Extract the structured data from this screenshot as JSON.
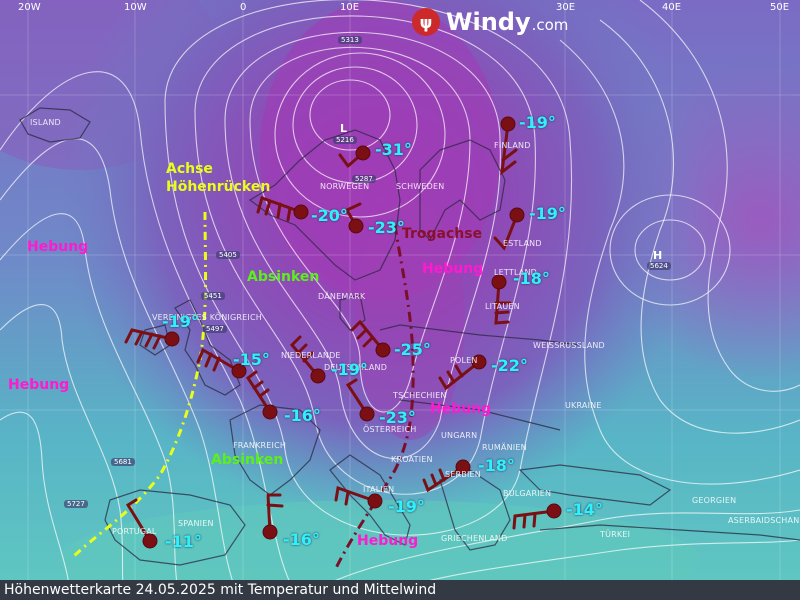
{
  "brand": {
    "name": "Windy",
    "suffix": ".com",
    "icon": "windy-logo-icon"
  },
  "caption": "Höhenwetterkarte 24.05.2025 mit Temperatur und Mittelwind",
  "longitudes": [
    "20W",
    "10W",
    "0",
    "10E",
    "30E",
    "40E",
    "50E"
  ],
  "pressure_labels": [
    "5313",
    "5216",
    "5287",
    "5405",
    "5451",
    "5497",
    "5681",
    "5727",
    "5624"
  ],
  "systems": {
    "low": "L",
    "high": "H"
  },
  "annotations": {
    "achse": [
      "Achse",
      "Höhenrücken"
    ],
    "trogachse": "Trogachse",
    "hebung": "Hebung",
    "absinken": "Absinken"
  },
  "countries": [
    "ISLAND",
    "FINLAND",
    "NORWEGEN",
    "SCHWEDEN",
    "ESTLAND",
    "LETTLAND",
    "LITAUEN",
    "DÄNEMARK",
    "VEREINIGTES KÖNIGREICH",
    "NIEDERLANDE",
    "DEUTSCHLAND",
    "POLEN",
    "WEISSRUSSLAND",
    "TSCHECHIEN",
    "ÖSTERREICH",
    "UKRAINE",
    "UNGARN",
    "RUMÄNIEN",
    "FRANKREICH",
    "KROATIEN",
    "ITALIEN",
    "SERBIEN",
    "BULGARIEN",
    "SPANIEN",
    "PORTUGAL",
    "GRIECHENLAND",
    "TÜRKEI",
    "GEORGIEN",
    "ASERBAIDSCHAN"
  ],
  "stations": [
    {
      "temp": "-31°"
    },
    {
      "temp": "-20°"
    },
    {
      "temp": "-23°"
    },
    {
      "temp": "-19°"
    },
    {
      "temp": "-19°"
    },
    {
      "temp": "-18°"
    },
    {
      "temp": "-19°"
    },
    {
      "temp": "-15°"
    },
    {
      "temp": "-19°"
    },
    {
      "temp": "-25°"
    },
    {
      "temp": "-22°"
    },
    {
      "temp": "-16°"
    },
    {
      "temp": "-23°"
    },
    {
      "temp": "-18°"
    },
    {
      "temp": "-19°"
    },
    {
      "temp": "-14°"
    },
    {
      "temp": "-11°"
    },
    {
      "temp": "-16°"
    }
  ],
  "colors": {
    "trough": "#7a0f2a",
    "ridge": "#e8ff1a",
    "station": "#7a0f14",
    "temp": "#2ff0ff",
    "hebung": "#ff1ad0",
    "absinken": "#5cf01a"
  }
}
